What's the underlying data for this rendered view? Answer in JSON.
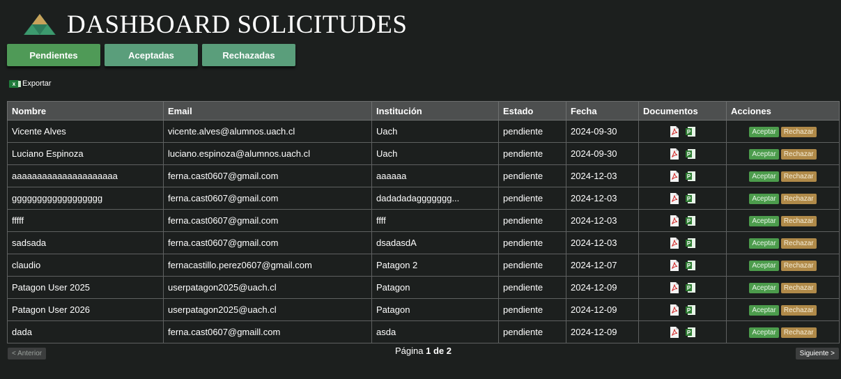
{
  "header": {
    "title": "DASHBOARD SOLICITUDES",
    "logo_icon": "mountain-logo-icon"
  },
  "tabs": [
    {
      "label": "Pendientes",
      "active": true
    },
    {
      "label": "Aceptadas",
      "active": false
    },
    {
      "label": "Rechazadas",
      "active": false
    }
  ],
  "export": {
    "label": "Exportar",
    "icon_text": "x"
  },
  "table": {
    "columns": [
      "Nombre",
      "Email",
      "Institución",
      "Estado",
      "Fecha",
      "Documentos",
      "Acciones"
    ],
    "accept_label": "Aceptar",
    "reject_label": "Rechazar",
    "rows": [
      {
        "nombre": "Vicente Alves",
        "email": "vicente.alves@alumnos.uach.cl",
        "institucion": "Uach",
        "estado": "pendiente",
        "fecha": "2024-09-30"
      },
      {
        "nombre": "Luciano Espinoza",
        "email": "luciano.espinoza@alumnos.uach.cl",
        "institucion": "Uach",
        "estado": "pendiente",
        "fecha": "2024-09-30"
      },
      {
        "nombre": "aaaaaaaaaaaaaaaaaaaaa",
        "email": "ferna.cast0607@gmail.com",
        "institucion": "aaaaaa",
        "estado": "pendiente",
        "fecha": "2024-12-03"
      },
      {
        "nombre": "gggggggggggggggggg",
        "email": "ferna.cast0607@gmail.com",
        "institucion": "dadadadaggggggg...",
        "estado": "pendiente",
        "fecha": "2024-12-03"
      },
      {
        "nombre": "fffff",
        "email": "ferna.cast0607@gmail.com",
        "institucion": "ffff",
        "estado": "pendiente",
        "fecha": "2024-12-03"
      },
      {
        "nombre": "sadsada",
        "email": "ferna.cast0607@gmail.com",
        "institucion": "dsadasdA",
        "estado": "pendiente",
        "fecha": "2024-12-03"
      },
      {
        "nombre": "claudio",
        "email": "fernacastillo.perez0607@gmail.com",
        "institucion": "Patagon 2",
        "estado": "pendiente",
        "fecha": "2024-12-07"
      },
      {
        "nombre": "Patagon User 2025",
        "email": "userpatagon2025@uach.cl",
        "institucion": "Patagon",
        "estado": "pendiente",
        "fecha": "2024-12-09"
      },
      {
        "nombre": "Patagon User 2026",
        "email": "userpatagon2025@uach.cl",
        "institucion": "Patagon",
        "estado": "pendiente",
        "fecha": "2024-12-09"
      },
      {
        "nombre": "dada",
        "email": "ferna.cast0607@gmaill.com",
        "institucion": "asda",
        "estado": "pendiente",
        "fecha": "2024-12-09"
      }
    ]
  },
  "pagination": {
    "prev_label": "< Anterior",
    "next_label": "Siguiente >",
    "page_prefix": "Página",
    "page_current": "1",
    "page_of": "de",
    "page_total": "2"
  },
  "colors": {
    "background": "#1c1f1e",
    "tab": "#5a9e7b",
    "accept": "#4c9c4c",
    "reject": "#b08a49"
  }
}
